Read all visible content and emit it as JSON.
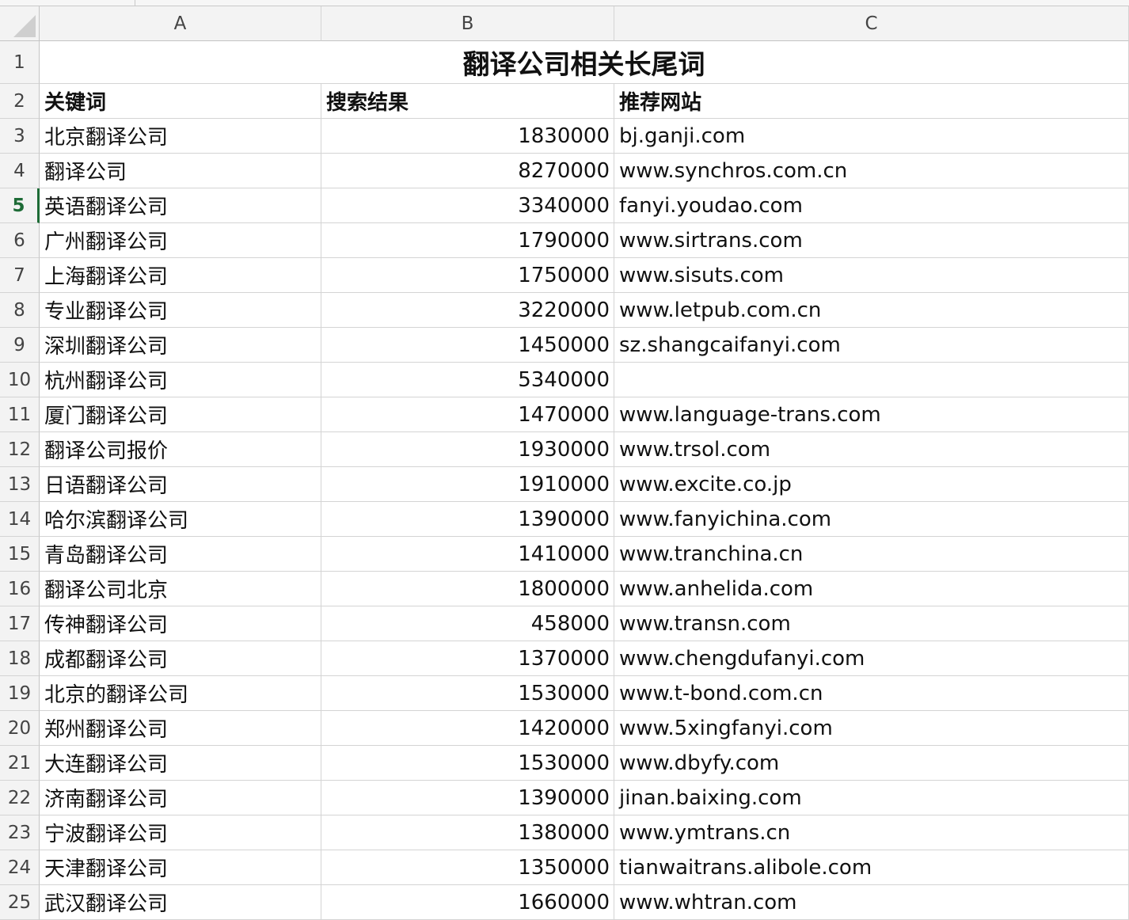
{
  "columns": [
    "A",
    "B",
    "C"
  ],
  "title": "翻译公司相关长尾词",
  "headers": {
    "keyword": "关键词",
    "results": "搜索结果",
    "site": "推荐网站"
  },
  "active_row": "5",
  "rows": [
    {
      "n": "3",
      "keyword": "北京翻译公司",
      "results": "1830000",
      "site": "bj.ganji.com"
    },
    {
      "n": "4",
      "keyword": "翻译公司",
      "results": "8270000",
      "site": "www.synchros.com.cn"
    },
    {
      "n": "5",
      "keyword": "英语翻译公司",
      "results": "3340000",
      "site": "fanyi.youdao.com"
    },
    {
      "n": "6",
      "keyword": "广州翻译公司",
      "results": "1790000",
      "site": "www.sirtrans.com"
    },
    {
      "n": "7",
      "keyword": "上海翻译公司",
      "results": "1750000",
      "site": "www.sisuts.com"
    },
    {
      "n": "8",
      "keyword": "专业翻译公司",
      "results": "3220000",
      "site": "www.letpub.com.cn"
    },
    {
      "n": "9",
      "keyword": "深圳翻译公司",
      "results": "1450000",
      "site": "sz.shangcaifanyi.com"
    },
    {
      "n": "10",
      "keyword": "杭州翻译公司",
      "results": "5340000",
      "site": ""
    },
    {
      "n": "11",
      "keyword": "厦门翻译公司",
      "results": "1470000",
      "site": "www.language-trans.com"
    },
    {
      "n": "12",
      "keyword": "翻译公司报价",
      "results": "1930000",
      "site": "www.trsol.com"
    },
    {
      "n": "13",
      "keyword": "日语翻译公司",
      "results": "1910000",
      "site": "www.excite.co.jp"
    },
    {
      "n": "14",
      "keyword": "哈尔滨翻译公司",
      "results": "1390000",
      "site": "www.fanyichina.com"
    },
    {
      "n": "15",
      "keyword": "青岛翻译公司",
      "results": "1410000",
      "site": "www.tranchina.cn"
    },
    {
      "n": "16",
      "keyword": "翻译公司北京",
      "results": "1800000",
      "site": "www.anhelida.com"
    },
    {
      "n": "17",
      "keyword": "传神翻译公司",
      "results": "458000",
      "site": "www.transn.com"
    },
    {
      "n": "18",
      "keyword": "成都翻译公司",
      "results": "1370000",
      "site": "www.chengdufanyi.com"
    },
    {
      "n": "19",
      "keyword": "北京的翻译公司",
      "results": "1530000",
      "site": "www.t-bond.com.cn"
    },
    {
      "n": "20",
      "keyword": "郑州翻译公司",
      "results": "1420000",
      "site": "www.5xingfanyi.com"
    },
    {
      "n": "21",
      "keyword": "大连翻译公司",
      "results": "1530000",
      "site": "www.dbyfy.com"
    },
    {
      "n": "22",
      "keyword": "济南翻译公司",
      "results": "1390000",
      "site": "jinan.baixing.com"
    },
    {
      "n": "23",
      "keyword": "宁波翻译公司",
      "results": "1380000",
      "site": "www.ymtrans.cn"
    },
    {
      "n": "24",
      "keyword": "天津翻译公司",
      "results": "1350000",
      "site": "tianwaitrans.alibole.com"
    },
    {
      "n": "25",
      "keyword": "武汉翻译公司",
      "results": "1660000",
      "site": "www.whtran.com"
    }
  ]
}
